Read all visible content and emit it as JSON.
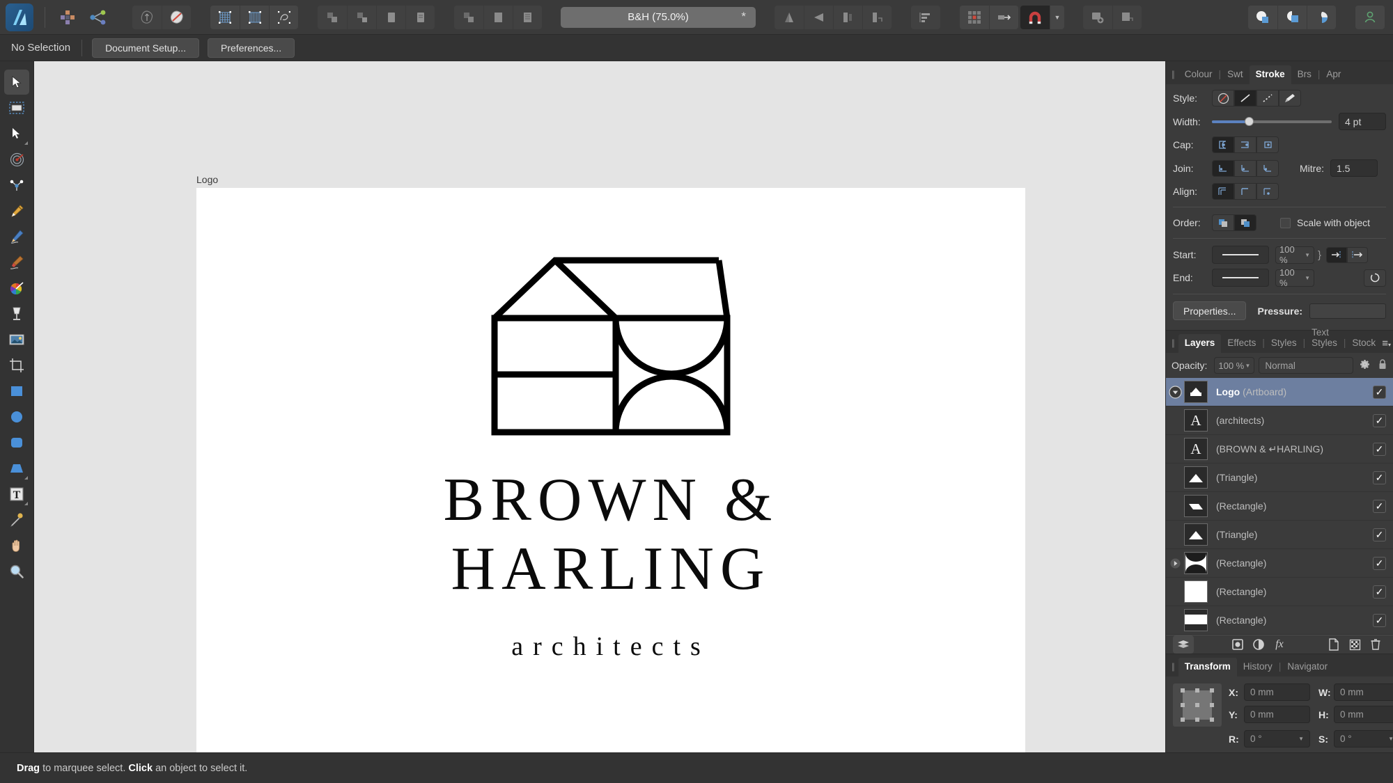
{
  "app": {
    "name": "Affinity Designer",
    "zoom_label": "B&H (75.0%)",
    "modified_marker": "*"
  },
  "toolbar": {
    "groups": [
      {
        "name": "app",
        "items": [
          {
            "icon": "affinity-designer-logo",
            "label": ""
          }
        ]
      },
      {
        "name": "persona",
        "items": [
          {
            "icon": "pixel-persona-icon",
            "label": ""
          },
          {
            "icon": "export-persona-icon",
            "label": ""
          }
        ]
      },
      {
        "name": "view-modes",
        "items": [
          {
            "icon": "vector-outline-icon",
            "label": ""
          },
          {
            "icon": "pixel-preview-icon",
            "label": ""
          }
        ]
      },
      {
        "name": "grid-modes",
        "items": [
          {
            "icon": "show-grid-icon",
            "label": ""
          },
          {
            "icon": "show-pixel-grid-icon",
            "label": ""
          },
          {
            "icon": "show-geometry-icon",
            "label": ""
          }
        ]
      },
      {
        "name": "boolean-ops",
        "items": [
          {
            "icon": "add-shapes-icon",
            "label": ""
          },
          {
            "icon": "subtract-shapes-icon",
            "label": ""
          },
          {
            "icon": "intersect-shapes-icon",
            "label": ""
          },
          {
            "icon": "divide-shapes-icon",
            "label": ""
          },
          {
            "icon": "combine-shapes-icon",
            "label": ""
          },
          {
            "icon": "merge-curves-icon",
            "label": ""
          },
          {
            "icon": "separate-curves-icon",
            "label": ""
          }
        ]
      },
      {
        "name": "transform-ops",
        "items": [
          {
            "icon": "flip-horizontal-icon",
            "label": ""
          },
          {
            "icon": "flip-vertical-icon",
            "label": ""
          },
          {
            "icon": "rotate-left-icon",
            "label": ""
          },
          {
            "icon": "rotate-right-icon",
            "label": ""
          }
        ]
      },
      {
        "name": "alignment",
        "items": [
          {
            "icon": "align-distribute-icon",
            "label": ""
          }
        ]
      },
      {
        "name": "snapping",
        "items": [
          {
            "icon": "snapping-grid-icon",
            "label": ""
          },
          {
            "icon": "move-to-icon",
            "label": ""
          },
          {
            "icon": "magnet-snapping-icon",
            "label": ""
          },
          {
            "icon": "snapping-options-caret",
            "label": ""
          }
        ]
      },
      {
        "name": "assets",
        "items": [
          {
            "icon": "add-artboard-icon",
            "label": ""
          },
          {
            "icon": "insert-behind-icon",
            "label": ""
          }
        ]
      },
      {
        "name": "studio",
        "items": [
          {
            "icon": "colour-studio-icon",
            "label": ""
          },
          {
            "icon": "layers-studio-icon",
            "label": ""
          },
          {
            "icon": "export-studio-icon",
            "label": ""
          }
        ]
      },
      {
        "name": "account",
        "items": [
          {
            "icon": "user-account-icon",
            "label": ""
          }
        ]
      }
    ]
  },
  "context_bar": {
    "selection_status": "No Selection",
    "buttons": [
      {
        "label": "Document Setup...",
        "name": "document-setup-button"
      },
      {
        "label": "Preferences...",
        "name": "preferences-button"
      }
    ]
  },
  "tools": [
    {
      "name": "move-tool",
      "icon": "arrow-cursor",
      "selected": true,
      "flyout": false
    },
    {
      "name": "artboard-tool",
      "icon": "artboard-frame",
      "selected": false,
      "flyout": false
    },
    {
      "name": "node-tool",
      "icon": "node-arrow",
      "selected": false,
      "flyout": true
    },
    {
      "name": "corner-tool",
      "icon": "corner-target",
      "selected": false,
      "flyout": false
    },
    {
      "name": "point-transform-tool",
      "icon": "point-transform",
      "selected": false,
      "flyout": false
    },
    {
      "name": "pen-tool",
      "icon": "fountain-pen",
      "selected": false,
      "flyout": false
    },
    {
      "name": "pencil-tool",
      "icon": "pencil",
      "selected": false,
      "flyout": false
    },
    {
      "name": "vector-brush-tool",
      "icon": "paint-brush",
      "selected": false,
      "flyout": false
    },
    {
      "name": "fill-tool",
      "icon": "colour-wheel",
      "selected": false,
      "flyout": false
    },
    {
      "name": "transparency-tool",
      "icon": "wine-glass",
      "selected": false,
      "flyout": false
    },
    {
      "name": "place-image-tool",
      "icon": "picture-frame",
      "selected": false,
      "flyout": false
    },
    {
      "name": "crop-tool",
      "icon": "crop-marks",
      "selected": false,
      "flyout": false
    },
    {
      "name": "rectangle-tool",
      "icon": "square-shape",
      "selected": false,
      "flyout": false
    },
    {
      "name": "ellipse-tool",
      "icon": "circle-shape",
      "selected": false,
      "flyout": false
    },
    {
      "name": "rounded-rectangle-tool",
      "icon": "rounded-square-shape",
      "selected": false,
      "flyout": false
    },
    {
      "name": "trapezoid-tool",
      "icon": "trapezoid-shape",
      "selected": false,
      "flyout": true
    },
    {
      "name": "frame-text-tool",
      "icon": "text-frame",
      "selected": false,
      "flyout": true
    },
    {
      "name": "colour-picker-tool",
      "icon": "eyedropper",
      "selected": false,
      "flyout": false
    },
    {
      "name": "view-pan-tool",
      "icon": "hand",
      "selected": false,
      "flyout": false
    },
    {
      "name": "zoom-tool",
      "icon": "magnifier",
      "selected": false,
      "flyout": false
    }
  ],
  "canvas": {
    "artboard_name": "Logo",
    "logo": {
      "line1": "BROWN &",
      "line2": "HARLING",
      "tagline": "architects",
      "stroke_colour": "#000000",
      "background": "#ffffff"
    }
  },
  "stroke_panel": {
    "tabs": [
      {
        "label": "Colour",
        "active": false
      },
      {
        "label": "Swt",
        "active": false
      },
      {
        "label": "Stroke",
        "active": true
      },
      {
        "label": "Brs",
        "active": false
      },
      {
        "label": "Apr",
        "active": false
      }
    ],
    "style_label": "Style:",
    "style_options": [
      "none-stroke",
      "solid-stroke",
      "dashed-stroke",
      "brush-stroke"
    ],
    "style_selected_index": 1,
    "width_label": "Width:",
    "width_value": "4 pt",
    "width_percent": 31,
    "cap_label": "Cap:",
    "cap_options": [
      "butt-cap",
      "round-cap",
      "square-cap"
    ],
    "cap_selected_index": 0,
    "join_label": "Join:",
    "join_options": [
      "mitre-join",
      "round-join",
      "bevel-join"
    ],
    "join_selected_index": 0,
    "mitre_label": "Mitre:",
    "mitre_value": "1.5",
    "align_label": "Align:",
    "align_options": [
      "align-centre",
      "align-inside",
      "align-outside"
    ],
    "align_selected_index": 0,
    "order_label": "Order:",
    "order_options": [
      "stroke-behind-fill",
      "stroke-above-fill"
    ],
    "order_selected_index": 1,
    "scale_with_object_label": "Scale with object",
    "scale_with_object_checked": false,
    "start_label": "Start:",
    "start_percent": "100 %",
    "end_label": "End:",
    "end_percent": "100 %",
    "arrow_swap_icons": [
      "swap-start-arrow-icon",
      "swap-end-arrow-icon"
    ],
    "reverse_icon": "reverse-path-icon",
    "properties_button": "Properties...",
    "pressure_label": "Pressure:"
  },
  "layers_panel": {
    "tabs": [
      {
        "label": "Layers",
        "active": true
      },
      {
        "label": "Effects",
        "active": false
      },
      {
        "label": "Styles",
        "active": false
      },
      {
        "label": "Text Styles",
        "active": false
      },
      {
        "label": "Stock",
        "active": false
      }
    ],
    "menu_icon": "panel-menu-icon",
    "opacity_label": "Opacity:",
    "opacity_value": "100 %",
    "blend_mode": "Normal",
    "gear_icon": "layer-effects-gear-icon",
    "lock_icon": "lock-icon",
    "rows": [
      {
        "name": "Logo",
        "suffix": " (Artboard)",
        "selected": true,
        "checked": true,
        "twisty": false,
        "disc": true,
        "thumb": "artboard-thumb"
      },
      {
        "name": "",
        "suffix": "(architects)",
        "selected": false,
        "checked": true,
        "twisty": false,
        "disc": false,
        "thumb": "text-A-thumb"
      },
      {
        "name": "",
        "suffix": "(BROWN & ↵HARLING)",
        "selected": false,
        "checked": true,
        "twisty": false,
        "disc": false,
        "thumb": "text-A-thumb"
      },
      {
        "name": "",
        "suffix": "(Triangle)",
        "selected": false,
        "checked": true,
        "twisty": false,
        "disc": false,
        "thumb": "triangle-thumb"
      },
      {
        "name": "",
        "suffix": "(Rectangle)",
        "selected": false,
        "checked": true,
        "twisty": false,
        "disc": false,
        "thumb": "parallelogram-thumb"
      },
      {
        "name": "",
        "suffix": "(Triangle)",
        "selected": false,
        "checked": true,
        "twisty": false,
        "disc": false,
        "thumb": "triangle-thumb"
      },
      {
        "name": "",
        "suffix": "(Rectangle)",
        "selected": false,
        "checked": true,
        "twisty": true,
        "disc": false,
        "thumb": "curves-thumb"
      },
      {
        "name": "",
        "suffix": "(Rectangle)",
        "selected": false,
        "checked": true,
        "twisty": false,
        "disc": false,
        "thumb": "solid-rect-thumb"
      },
      {
        "name": "",
        "suffix": "(Rectangle)",
        "selected": false,
        "checked": true,
        "twisty": false,
        "disc": false,
        "thumb": "wide-rect-thumb"
      }
    ],
    "footer_icons": [
      "layer-stack-icon",
      "mask-layer-icon",
      "adjustment-layer-icon",
      "fx-icon",
      "new-layer-icon",
      "new-pixel-layer-icon",
      "delete-layer-icon"
    ]
  },
  "transform_panel": {
    "tabs": [
      {
        "label": "Transform",
        "active": true
      },
      {
        "label": "History",
        "active": false
      },
      {
        "label": "Navigator",
        "active": false
      }
    ],
    "fields": [
      {
        "label": "X:",
        "value": "0 mm"
      },
      {
        "label": "W:",
        "value": "0 mm"
      },
      {
        "label": "Y:",
        "value": "0 mm"
      },
      {
        "label": "H:",
        "value": "0 mm"
      },
      {
        "label": "R:",
        "value": "0 °"
      },
      {
        "label": "S:",
        "value": "0 °"
      }
    ],
    "link_icon": "link-ratio-icon",
    "anchor_icon": "transform-anchor-icon"
  },
  "status_bar": {
    "prefix_bold": "Drag",
    "mid": " to marquee select. ",
    "second_bold": "Click",
    "suffix": " an object to select it."
  },
  "colors": {
    "chrome": "#3b3b3b",
    "chrome_dark": "#333333",
    "canvas_bg": "#e4e4e4",
    "selection_blue": "#6d7fa0",
    "accent_blue": "#5b82c0",
    "magnet_red": "#c94040"
  }
}
